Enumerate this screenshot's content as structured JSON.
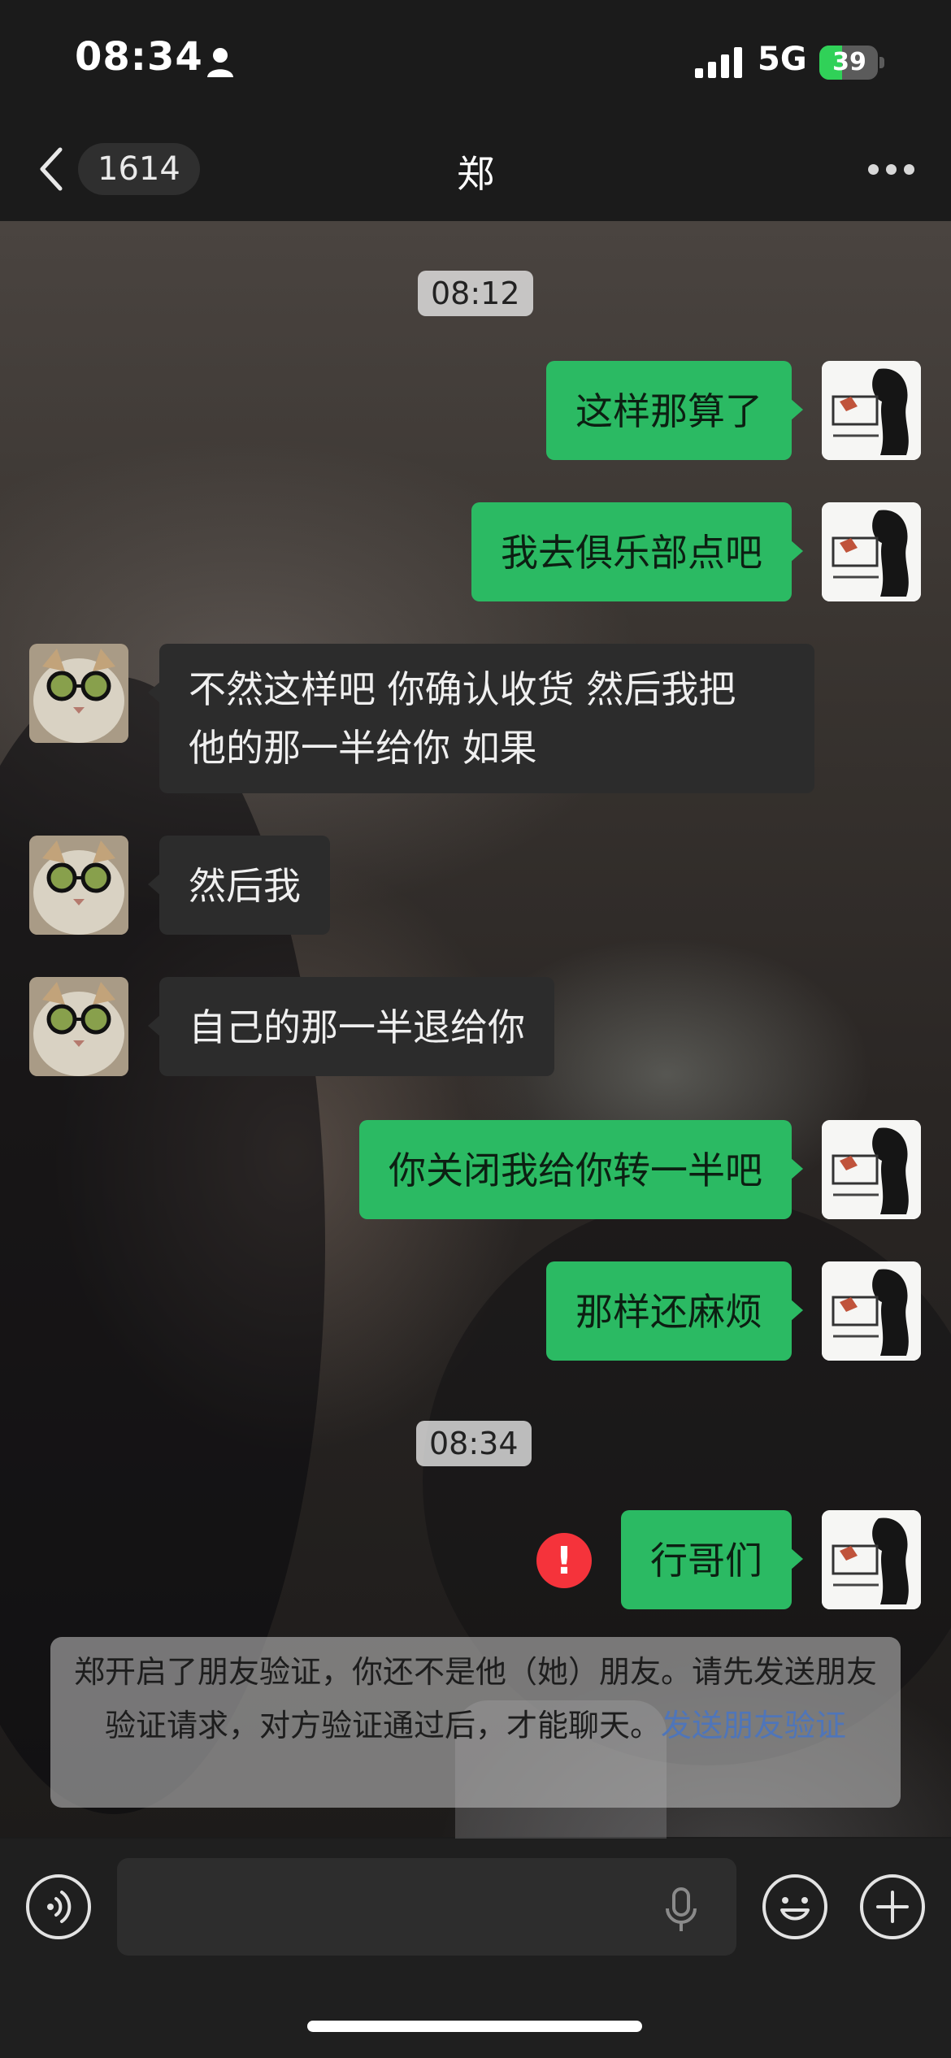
{
  "status_bar": {
    "time": "08:34",
    "network": "5G",
    "battery": "39",
    "battery_level": 0.39,
    "icons": [
      "person-icon",
      "signal-icon",
      "battery-icon"
    ]
  },
  "nav": {
    "back_icon": "chevron-left-icon",
    "unread_count": "1614",
    "title": "郑",
    "more_icon": "more-dots-icon"
  },
  "messages": [
    {
      "type": "time",
      "text": "08:12"
    },
    {
      "type": "out",
      "text": "这样那算了"
    },
    {
      "type": "out",
      "text": "我去俱乐部点吧"
    },
    {
      "type": "in",
      "text": "不然这样吧 你确认收货 然后我把\n他的那一半给你 如果"
    },
    {
      "type": "in",
      "text": "然后我"
    },
    {
      "type": "in",
      "text": "自己的那一半退给你"
    },
    {
      "type": "out",
      "text": "你关闭我给你转一半吧"
    },
    {
      "type": "out",
      "text": "那样还麻烦"
    },
    {
      "type": "time",
      "text": "08:34"
    },
    {
      "type": "out",
      "text": "行哥们",
      "failed": true
    }
  ],
  "notice": {
    "text": "郑开启了朋友验证，你还不是他（她）朋友。请先发送朋友验证请求，对方验证通过后，才能聊天。",
    "link": "发送朋友验证"
  },
  "input_bar": {
    "voice_icon": "voice-icon",
    "mic_icon": "microphone-icon",
    "emoji_icon": "emoji-icon",
    "plus_icon": "plus-icon"
  },
  "colors": {
    "outgoing_bubble": "#2bba63",
    "incoming_bubble": "#2c2c2c",
    "link": "#4f75b9",
    "error": "#f5333b"
  }
}
